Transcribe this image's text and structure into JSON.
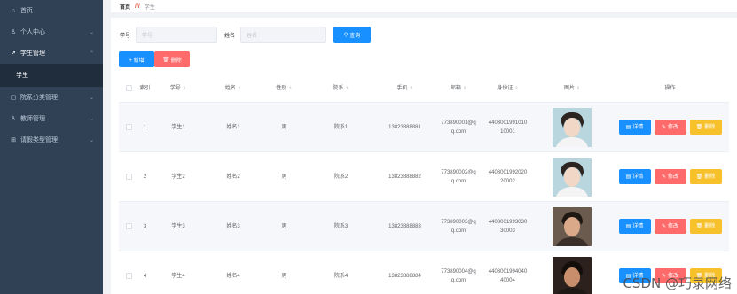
{
  "sidebar": {
    "items": [
      {
        "label": "首页",
        "icon": "home-icon"
      },
      {
        "label": "个人中心",
        "icon": "user-icon"
      },
      {
        "label": "学生管理",
        "icon": "send-icon"
      },
      {
        "label": "学生",
        "icon": ""
      },
      {
        "label": "院系分类管理",
        "icon": "document-icon"
      },
      {
        "label": "教师管理",
        "icon": "user-icon"
      },
      {
        "label": "请假类型管理",
        "icon": "grid-icon"
      }
    ]
  },
  "breadcrumb": {
    "home": "首页",
    "separator": "///",
    "current": "学生"
  },
  "search": {
    "xh_label": "学号",
    "xh_placeholder": "学号",
    "xm_label": "姓名",
    "xm_placeholder": "姓名",
    "query_label": "查询"
  },
  "toolbar": {
    "add_label": "+ 新增",
    "delete_label": "删除"
  },
  "table": {
    "headers": [
      "索引",
      "学号",
      "姓名",
      "性别",
      "院系",
      "手机",
      "邮箱",
      "身份证",
      "图片",
      "操作"
    ],
    "rows": [
      {
        "idx": "1",
        "xh": "学生1",
        "xm": "姓名1",
        "xb": "男",
        "yx": "院系1",
        "sj": "13823888881",
        "yj1": "773890001@q",
        "yj2": "q.com",
        "sfz1": "4403001991010",
        "sfz2": "10001"
      },
      {
        "idx": "2",
        "xh": "学生2",
        "xm": "姓名2",
        "xb": "男",
        "yx": "院系2",
        "sj": "13823888882",
        "yj1": "773890002@q",
        "yj2": "q.com",
        "sfz1": "4403001992020",
        "sfz2": "20002"
      },
      {
        "idx": "3",
        "xh": "学生3",
        "xm": "姓名3",
        "xb": "男",
        "yx": "院系3",
        "sj": "13823888883",
        "yj1": "773890003@q",
        "yj2": "q.com",
        "sfz1": "4403001993030",
        "sfz2": "30003"
      },
      {
        "idx": "4",
        "xh": "学生4",
        "xm": "姓名4",
        "xb": "男",
        "yx": "院系4",
        "sj": "13823888884",
        "yj1": "773890004@q",
        "yj2": "q.com",
        "sfz1": "4403001994040",
        "sfz2": "40004"
      }
    ],
    "actions": {
      "detail": "详情",
      "edit": "修改",
      "delete": "删除"
    }
  },
  "watermark": "CSDN @巧录网络",
  "colors": {
    "sidebar": "#304156",
    "primary": "#1890ff",
    "danger": "#ff6a6a",
    "warning": "#f7c12c"
  }
}
